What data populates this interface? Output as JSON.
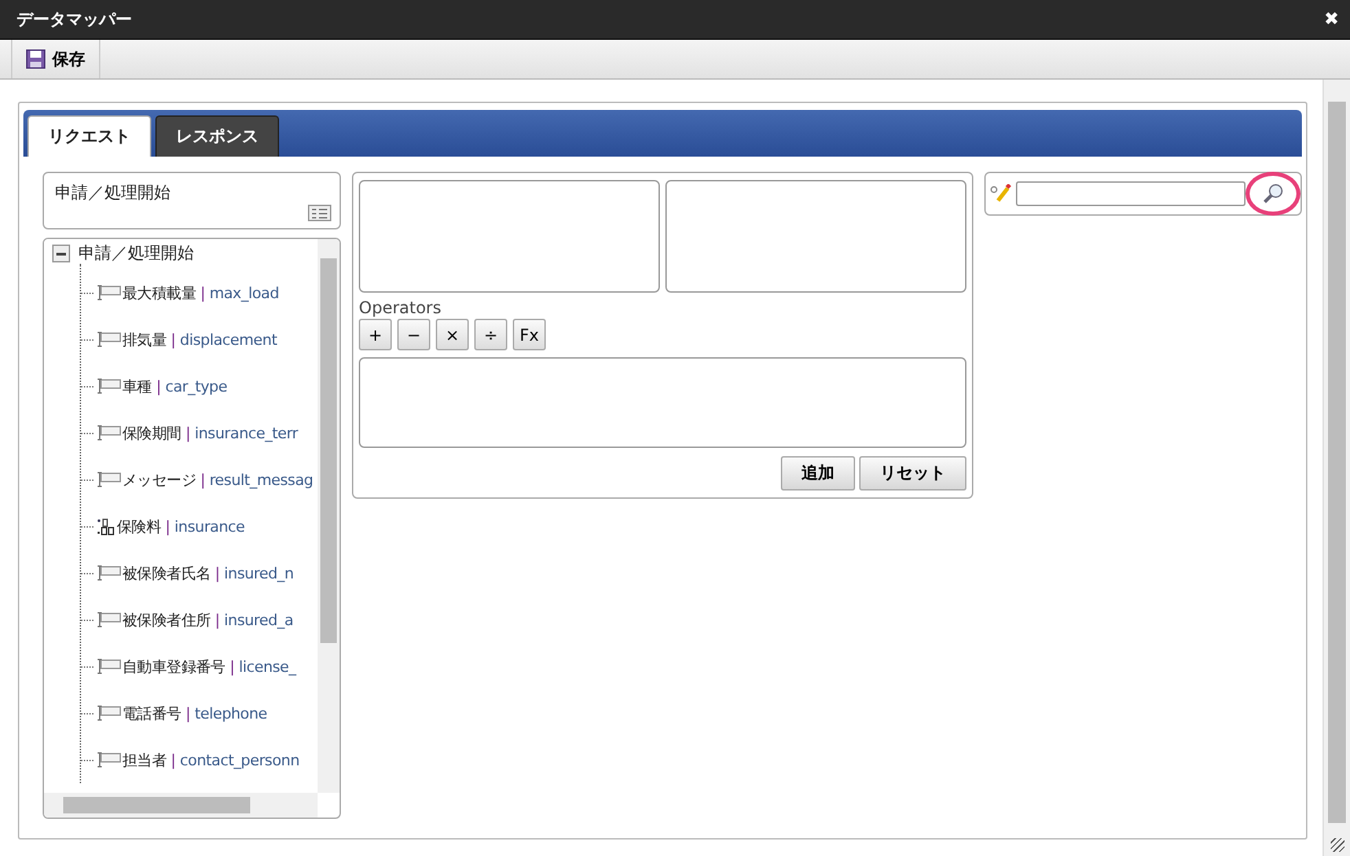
{
  "window": {
    "title": "データマッパー",
    "close": "✖"
  },
  "toolbar": [
    {
      "label": "保存",
      "kind": "save"
    }
  ],
  "tabs": [
    {
      "label": "リクエスト",
      "selected": true
    },
    {
      "label": "レスポンス",
      "selected": false
    }
  ],
  "source": {
    "header": "申請／処理開始",
    "tree": {
      "label": "申請／処理開始",
      "expanded": true,
      "children": [
        {
          "name": "最大積載量",
          "sep": "|",
          "field": "max_load",
          "kind": "text"
        },
        {
          "name": "排気量",
          "sep": "|",
          "field": "displacement",
          "kind": "text"
        },
        {
          "name": "車種",
          "sep": "|",
          "field": "car_type",
          "kind": "text"
        },
        {
          "name": "保険期間",
          "sep": "|",
          "field": "insurance_terr",
          "kind": "text"
        },
        {
          "name": "メッセージ",
          "sep": "|",
          "field": "result_messag",
          "kind": "text"
        },
        {
          "name": "保険料",
          "sep": "|",
          "field": "insurance",
          "kind": "number"
        },
        {
          "name": "被保険者氏名",
          "sep": "|",
          "field": "insured_n",
          "kind": "text"
        },
        {
          "name": "被保険者住所",
          "sep": "|",
          "field": "insured_a",
          "kind": "text"
        },
        {
          "name": "自動車登録番号",
          "sep": "|",
          "field": "license_",
          "kind": "text"
        },
        {
          "name": "電話番号",
          "sep": "|",
          "field": "telephone",
          "kind": "text"
        },
        {
          "name": "担当者",
          "sep": "|",
          "field": "contact_personn",
          "kind": "text"
        }
      ]
    }
  },
  "editor": {
    "operators_label": "Operators",
    "operators": [
      "+",
      "−",
      "×",
      "÷",
      "Fx"
    ],
    "buttons": [
      "追加",
      "リセット"
    ]
  },
  "search": {
    "highlighted": true
  }
}
